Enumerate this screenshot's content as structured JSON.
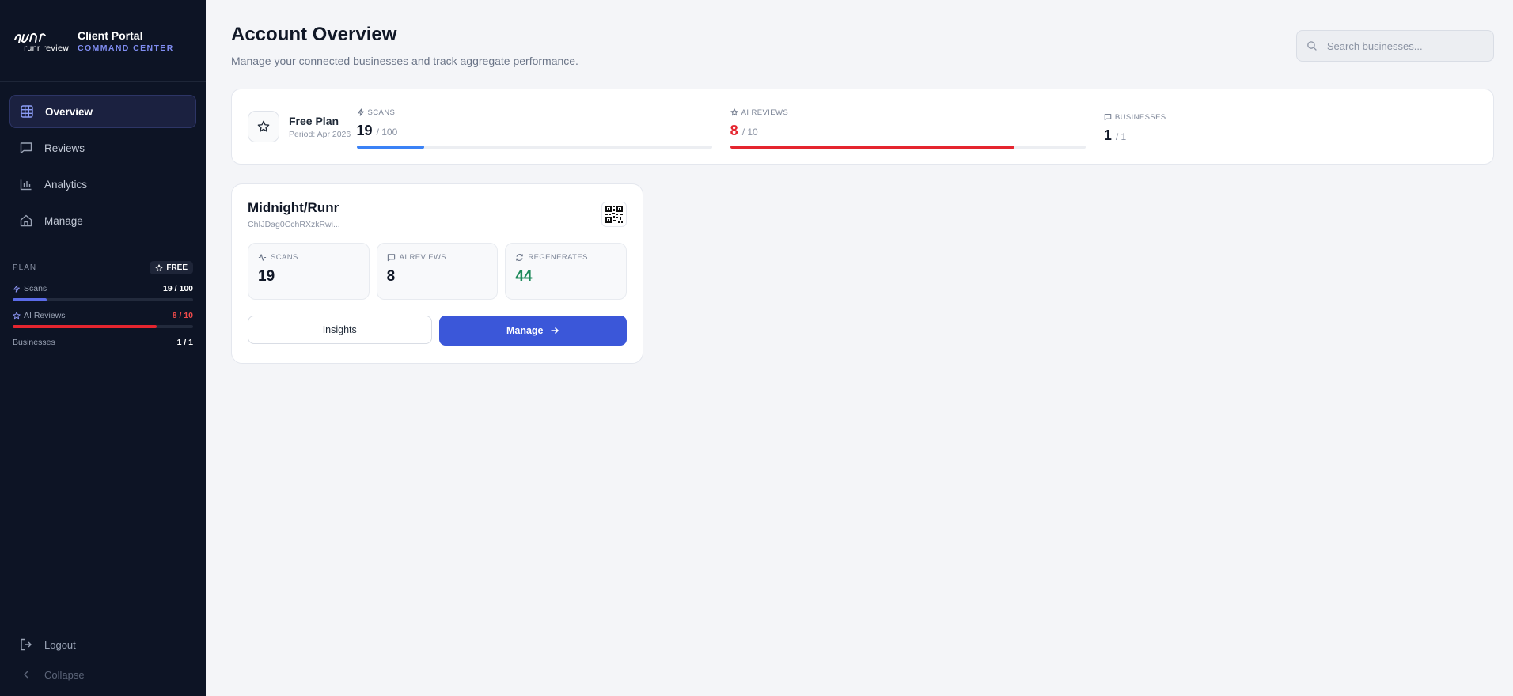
{
  "brand": {
    "logo_text": "runr review",
    "title": "Client Portal",
    "subtitle": "COMMAND CENTER"
  },
  "nav": [
    {
      "label": "Overview",
      "icon": "grid-icon",
      "active": true
    },
    {
      "label": "Reviews",
      "icon": "message-square-icon",
      "active": false
    },
    {
      "label": "Analytics",
      "icon": "bar-chart-icon",
      "active": false
    },
    {
      "label": "Manage",
      "icon": "home-icon",
      "active": false
    }
  ],
  "sidebar_plan": {
    "label": "PLAN",
    "badge": "FREE",
    "rows": [
      {
        "label": "Scans",
        "value": "19 / 100",
        "fraction": 0.19,
        "color": "#5b6be8"
      },
      {
        "label": "AI Reviews",
        "value": "8 / 10",
        "fraction": 0.8,
        "color": "#e5252f"
      },
      {
        "label": "Businesses",
        "value": "1 / 1"
      }
    ]
  },
  "sidebar_bottom": {
    "logout": "Logout",
    "collapse": "Collapse"
  },
  "header": {
    "title": "Account Overview",
    "subtitle": "Manage your connected businesses and track aggregate performance.",
    "search_placeholder": "Search businesses..."
  },
  "summary": {
    "plan_name": "Free Plan",
    "period": "Period: Apr 2026",
    "metrics": [
      {
        "label": "SCANS",
        "value": "19",
        "of": "/ 100",
        "fraction": 0.19,
        "color": "#3b82f6",
        "highlight": false
      },
      {
        "label": "AI REVIEWS",
        "value": "8",
        "of": "/ 10",
        "fraction": 0.8,
        "color": "#e5252f",
        "highlight": true
      },
      {
        "label": "BUSINESSES",
        "value": "1",
        "of": "/ 1"
      }
    ]
  },
  "business": {
    "name": "Midnight/Runr",
    "id": "ChIJDag0CchRXzkRwi...",
    "stats": [
      {
        "label": "SCANS",
        "value": "19"
      },
      {
        "label": "AI REVIEWS",
        "value": "8"
      },
      {
        "label": "REGENERATES",
        "value": "44"
      }
    ],
    "insights_label": "Insights",
    "manage_label": "Manage"
  },
  "colors": {
    "sidebar_bg": "#0d1425",
    "accent": "#3b57d9",
    "danger": "#e5252f",
    "success": "#1e8a5b"
  }
}
